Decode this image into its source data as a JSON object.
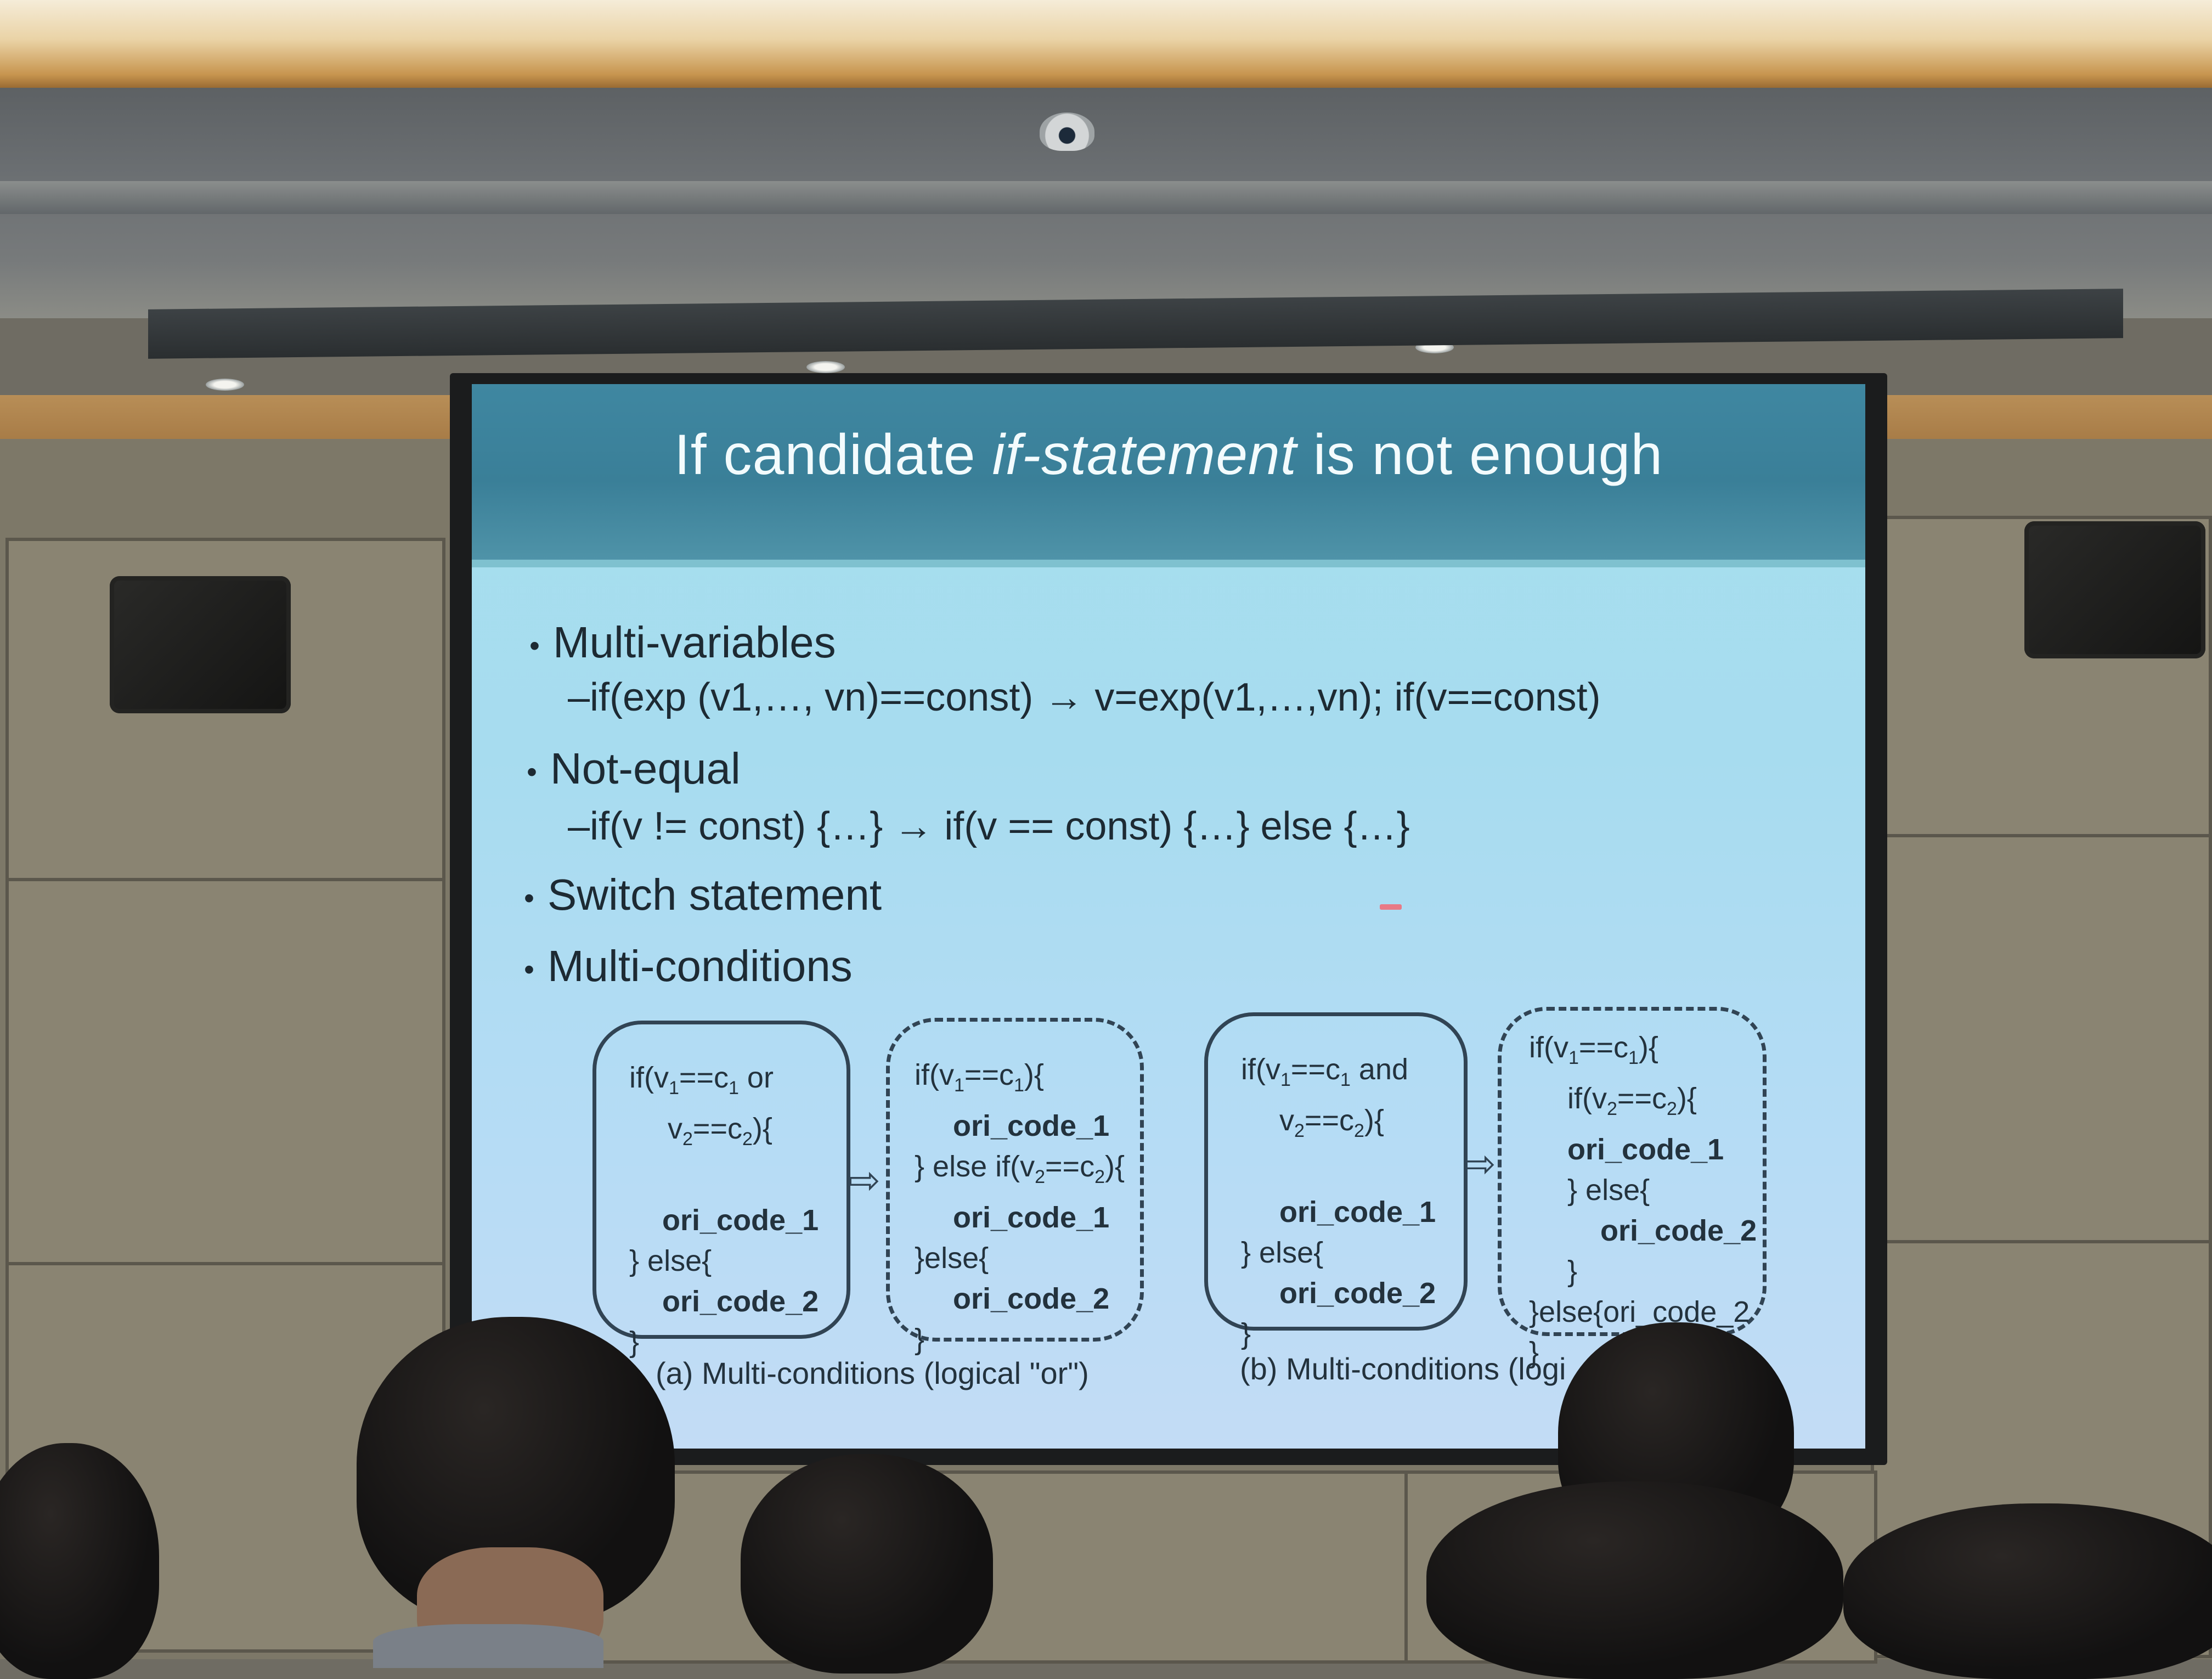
{
  "slide": {
    "title_prefix": "If candidate ",
    "title_emphasis": "if-statement",
    "title_suffix": " is not enough",
    "bullets": [
      {
        "label": "Multi-variables",
        "detail": "–if(exp (v1,…, vn)==const)  → v=exp(v1,…,vn); if(v==const)"
      },
      {
        "label": "Not-equal",
        "detail": "–if(v != const) {…} → if(v == const) {…}  else {…}"
      },
      {
        "label": "Switch statement",
        "detail": ""
      },
      {
        "label": "Multi-conditions",
        "detail": ""
      }
    ],
    "bullet_symbol": "•",
    "diagram": {
      "arrow_symbol": "⇨",
      "box_a_before": [
        "if(v1==c1 or",
        "v2==c2){",
        "",
        "ori_code_1",
        "} else{",
        "ori_code_2",
        "}"
      ],
      "box_a_after": [
        "if(v1==c1){",
        "ori_code_1",
        "} else if(v2==c2){",
        "ori_code_1",
        "}else{",
        "ori_code_2",
        "}"
      ],
      "box_b_before": [
        "if(v1==c1 and",
        "v2==c2){",
        "",
        "ori_code_1",
        "} else{",
        "ori_code_2",
        "}"
      ],
      "box_b_after": [
        "if(v1==c1){",
        "if(v2==c2){",
        "ori_code_1",
        "} else{",
        "ori_code_2",
        "}",
        "}else{ori_code_2",
        "}"
      ],
      "caption_a": "(a) Multi-conditions (logical \"or\")",
      "caption_b": "(b) Multi-conditions (logi"
    }
  }
}
